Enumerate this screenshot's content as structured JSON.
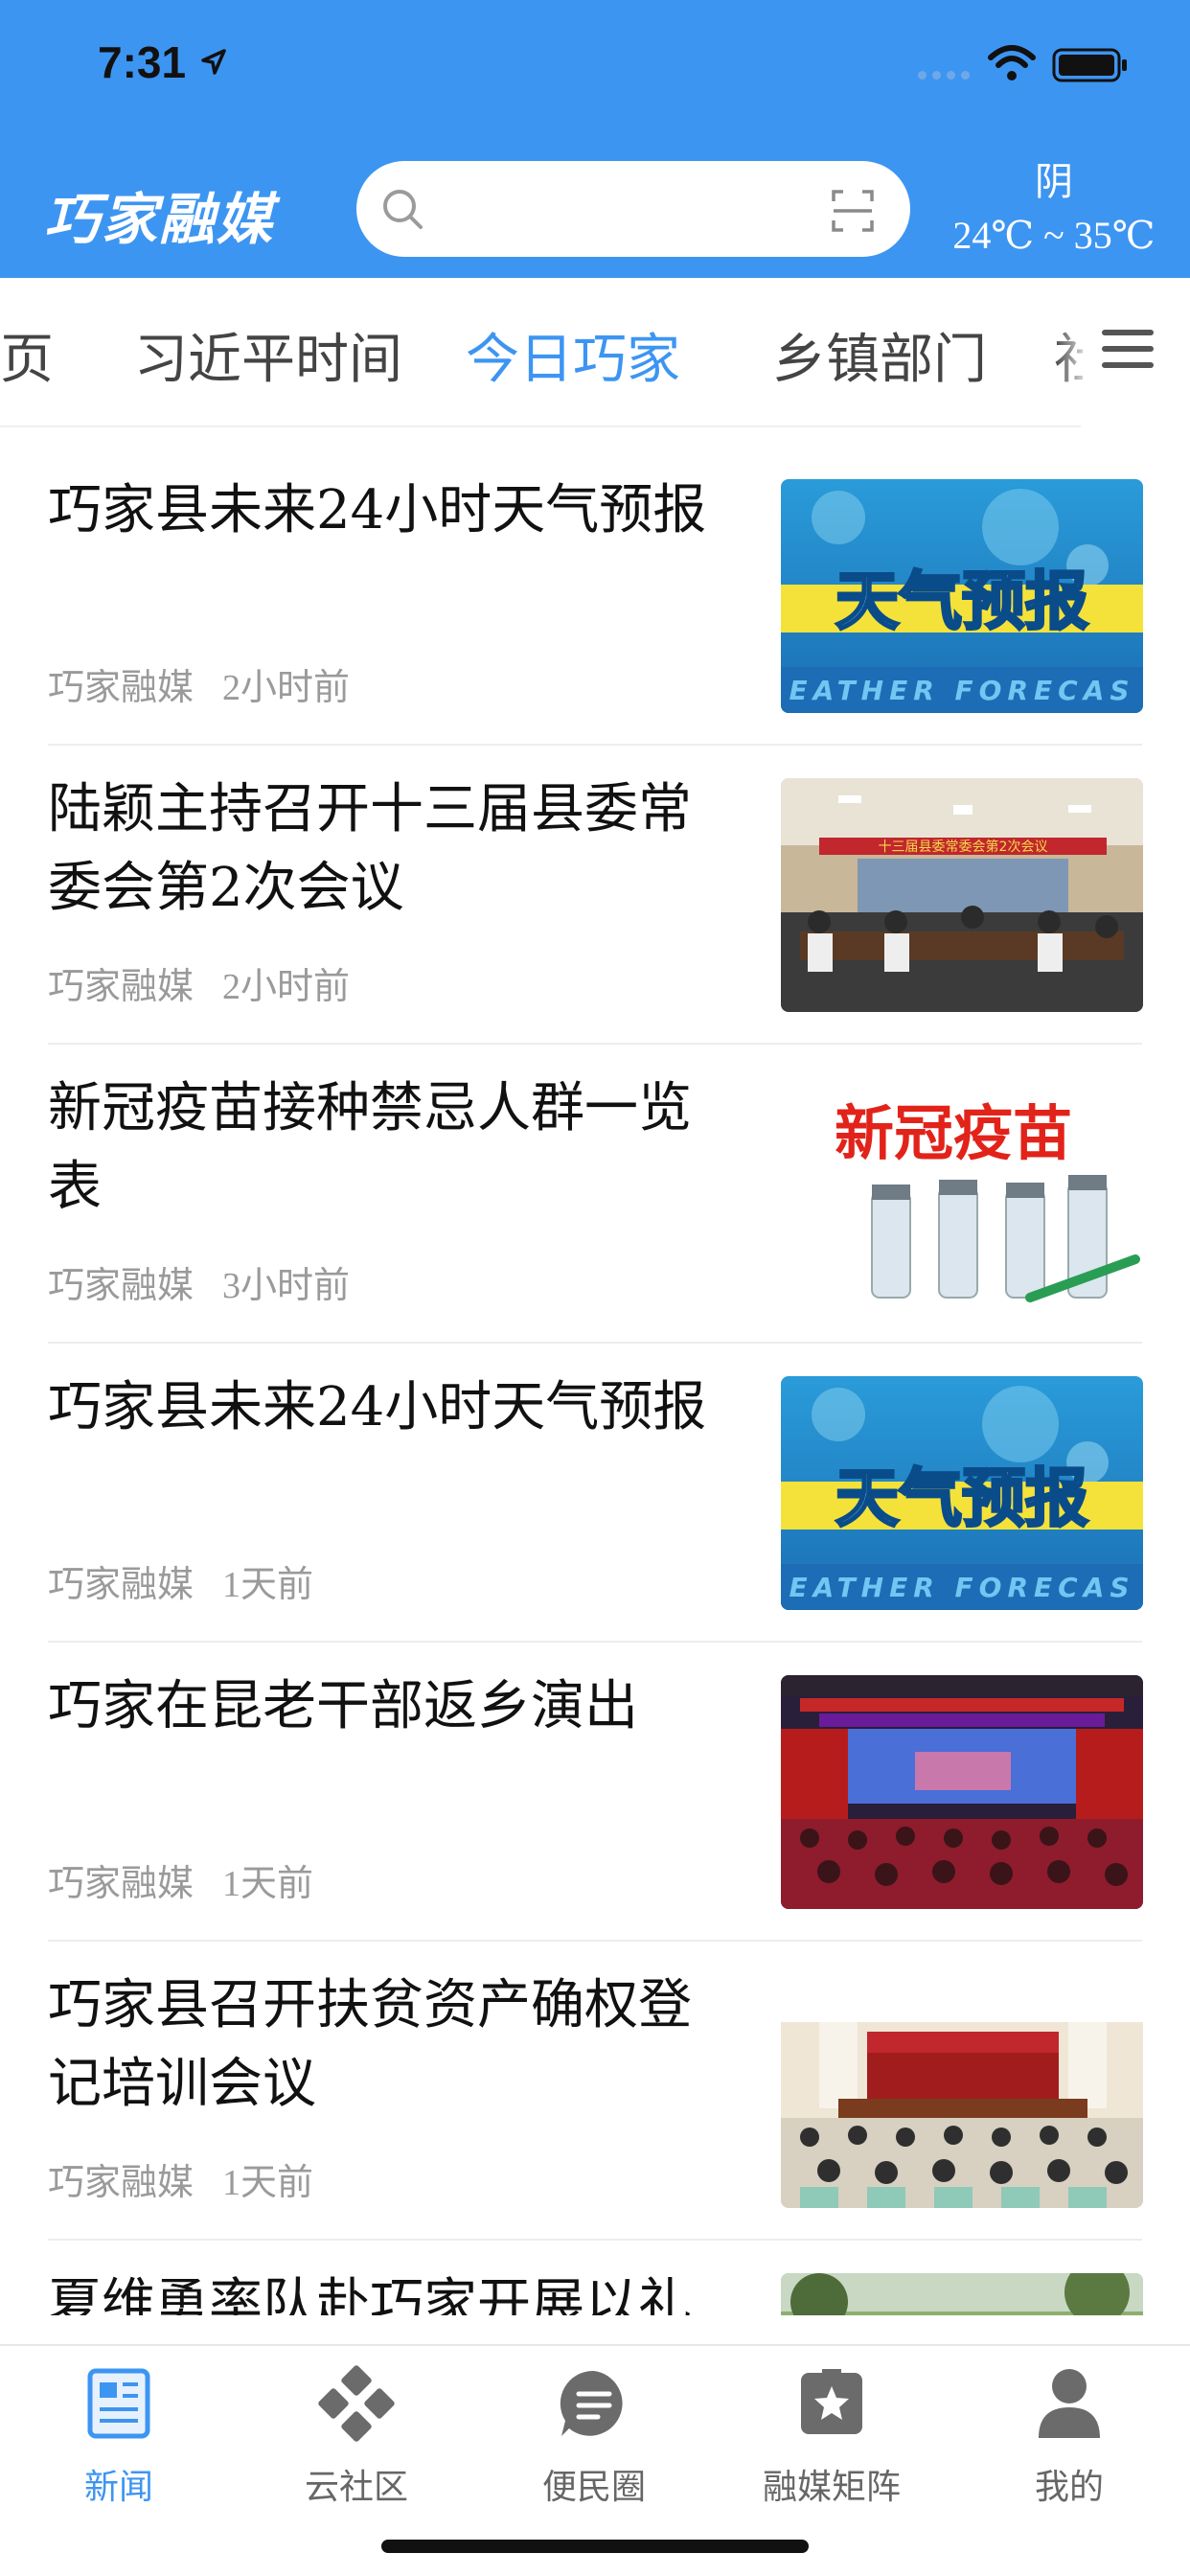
{
  "status_bar": {
    "time": "7:31"
  },
  "header": {
    "logo_text": "巧家融媒",
    "search": {
      "placeholder": ""
    },
    "weather": {
      "condition": "阴",
      "temperature": "24℃ ~ 35℃"
    }
  },
  "tabs": [
    {
      "label": "页"
    },
    {
      "label": "习近平时间"
    },
    {
      "label": "今日巧家"
    },
    {
      "label": "乡镇部门"
    },
    {
      "label": "社"
    }
  ],
  "active_tab": "今日巧家",
  "news": [
    {
      "title": "巧家县未来24小时天气预报",
      "source": "巧家融媒",
      "time": "2小时前",
      "thumb_text": "天气预报",
      "thumb_sub": "EATHER FORECAS"
    },
    {
      "title": "陆颖主持召开十三届县委常委会第2次会议",
      "source": "巧家融媒",
      "time": "2小时前",
      "thumb_text": "十三届县委常委会第2次会议"
    },
    {
      "title": "新冠疫苗接种禁忌人群一览表",
      "source": "巧家融媒",
      "time": "3小时前",
      "thumb_text": "新冠疫苗"
    },
    {
      "title": "巧家县未来24小时天气预报",
      "source": "巧家融媒",
      "time": "1天前",
      "thumb_text": "天气预报",
      "thumb_sub": "EATHER FORECAS"
    },
    {
      "title": "巧家在昆老干部返乡演出",
      "source": "巧家融媒",
      "time": "1天前"
    },
    {
      "title": "巧家县召开扶贫资产确权登记培训会议",
      "source": "巧家融媒",
      "time": "1天前"
    },
    {
      "title": "夏维勇率队赴巧家开展以礼",
      "source": "",
      "time": ""
    }
  ],
  "bottom_nav": [
    {
      "label": "新闻",
      "icon": "news-icon"
    },
    {
      "label": "云社区",
      "icon": "community-icon"
    },
    {
      "label": "便民圈",
      "icon": "chat-icon"
    },
    {
      "label": "融媒矩阵",
      "icon": "star-icon"
    },
    {
      "label": "我的",
      "icon": "user-icon"
    }
  ],
  "colors": {
    "accent": "#3d95f2",
    "header_bg": "#3d95f2",
    "meta_gray": "#9a9a9a"
  }
}
